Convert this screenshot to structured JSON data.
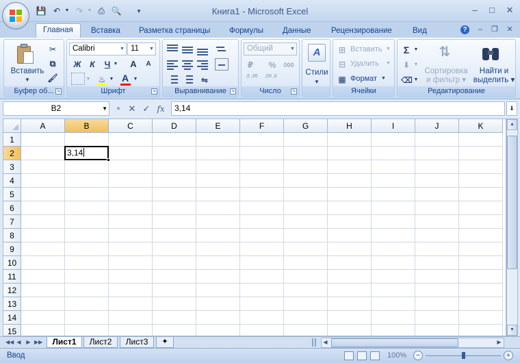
{
  "window": {
    "title": "Книга1 - Microsoft Excel"
  },
  "ribbon_tabs": [
    "Главная",
    "Вставка",
    "Разметка страницы",
    "Формулы",
    "Данные",
    "Рецензирование",
    "Вид"
  ],
  "groups": {
    "clipboard": {
      "label": "Буфер об...",
      "paste": "Вставить"
    },
    "font": {
      "label": "Шрифт",
      "font_name": "Calibri",
      "font_size": "11",
      "bold": "Ж",
      "italic": "К",
      "underline": "Ч",
      "grow": "A",
      "shrink": "A"
    },
    "alignment": {
      "label": "Выравнивание"
    },
    "number": {
      "label": "Число",
      "format": "Общий",
      "percent": "%",
      "thousands": "000",
      "inc_decimal": ",0 ,00",
      "dec_decimal": ",00 ,0"
    },
    "styles": {
      "label": "Стили"
    },
    "cells": {
      "label": "Ячейки",
      "insert": "Вставить",
      "delete": "Удалить",
      "format": "Формат"
    },
    "editing": {
      "label": "Редактирование",
      "sort_filter_1": "Сортировка",
      "sort_filter_2": "и фильтр",
      "find_1": "Найти и",
      "find_2": "выделить"
    }
  },
  "formula_bar": {
    "name_box": "B2",
    "formula": "3,14",
    "fx": "fx"
  },
  "grid": {
    "columns": [
      "A",
      "B",
      "C",
      "D",
      "E",
      "F",
      "G",
      "H",
      "I",
      "J",
      "K"
    ],
    "rows": [
      "1",
      "2",
      "3",
      "4",
      "5",
      "6",
      "7",
      "8",
      "9",
      "10",
      "11",
      "12",
      "13",
      "14",
      "15"
    ],
    "selected_column": "B",
    "selected_row": "2",
    "active_cell_value": "3,14"
  },
  "sheets": [
    "Лист1",
    "Лист2",
    "Лист3"
  ],
  "status": {
    "mode": "Ввод",
    "zoom": "100%"
  },
  "colors": {
    "accent": "#15428b",
    "selection_header": "#f1c15f"
  }
}
